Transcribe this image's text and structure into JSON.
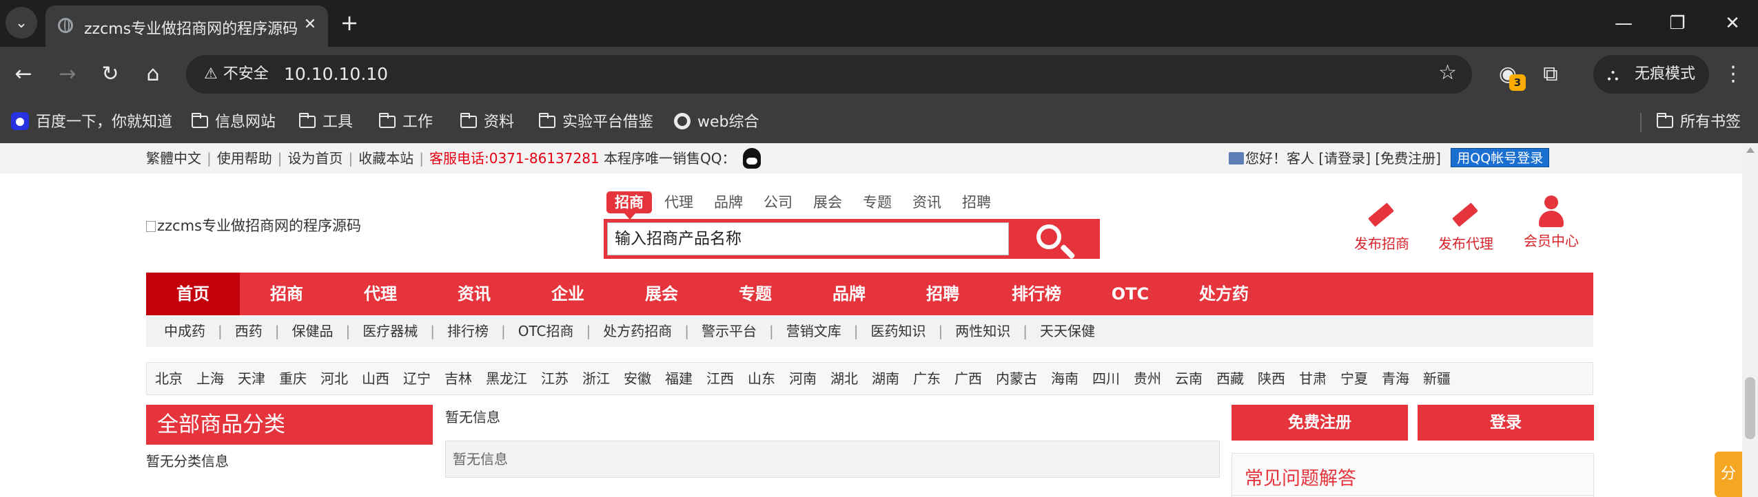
{
  "browser": {
    "tab_title": "zzcms专业做招商网的程序源码",
    "security_label": "不安全",
    "url": "10.10.10.10",
    "extension_badge": "3",
    "incognito_label": "无痕模式",
    "bookmarks": [
      {
        "label": "百度一下，你就知道",
        "icon": "baidu-icon"
      },
      {
        "label": "信息网站",
        "icon": "folder-icon"
      },
      {
        "label": "工具",
        "icon": "folder-icon"
      },
      {
        "label": "工作",
        "icon": "folder-icon"
      },
      {
        "label": "资料",
        "icon": "folder-icon"
      },
      {
        "label": "实验平台借鉴",
        "icon": "folder-icon"
      },
      {
        "label": "web综合",
        "icon": "globe-icon"
      }
    ],
    "all_bookmarks": "所有书签"
  },
  "topbar": {
    "traditional": "繁體中文",
    "help": "使用帮助",
    "set_home": "设为首页",
    "favorite": "收藏本站",
    "hotline": "客服电话:0371-86137281",
    "qq_text": "本程序唯一销售QQ：",
    "greeting": "您好！客人",
    "login": "[请登录]",
    "register": "[免费注册]",
    "qq_login": "用QQ帐号登录"
  },
  "logo_alt": "zzcms专业做招商网的程序源码",
  "search": {
    "tabs": [
      "招商",
      "代理",
      "品牌",
      "公司",
      "展会",
      "专题",
      "资讯",
      "招聘"
    ],
    "placeholder": "输入招商产品名称"
  },
  "quick_actions": [
    "发布招商",
    "发布代理",
    "会员中心"
  ],
  "main_nav": [
    "首页",
    "招商",
    "代理",
    "资讯",
    "企业",
    "展会",
    "专题",
    "品牌",
    "招聘",
    "排行榜",
    "OTC",
    "处方药"
  ],
  "sub_nav": [
    "中成药",
    "西药",
    "保健品",
    "医疗器械",
    "排行榜",
    "OTC招商",
    "处方药招商",
    "警示平台",
    "营销文库",
    "医药知识",
    "两性知识",
    "天天保健"
  ],
  "cities": [
    "北京",
    "上海",
    "天津",
    "重庆",
    "河北",
    "山西",
    "辽宁",
    "吉林",
    "黑龙江",
    "江苏",
    "浙江",
    "安徽",
    "福建",
    "江西",
    "山东",
    "河南",
    "湖北",
    "湖南",
    "广东",
    "广西",
    "内蒙古",
    "海南",
    "四川",
    "贵州",
    "云南",
    "西藏",
    "陕西",
    "甘肃",
    "宁夏",
    "青海",
    "新疆"
  ],
  "categories": {
    "title": "全部商品分类",
    "empty": "暂无分类信息"
  },
  "middle": {
    "title": "暂无信息",
    "empty": "暂无信息"
  },
  "side": {
    "register": "免费注册",
    "login": "登录",
    "faq_title": "常见问题解答"
  },
  "share_label": "分",
  "colors": {
    "brand_red": "#e5343c",
    "active_red": "#c4000a",
    "hotline_red": "#e60012"
  }
}
